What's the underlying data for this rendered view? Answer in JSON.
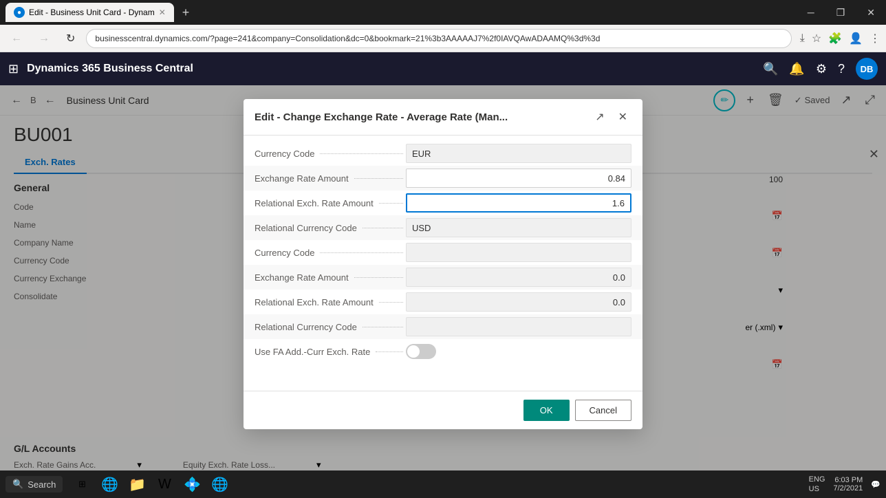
{
  "browser": {
    "tab_title": "Edit - Business Unit Card - Dynam",
    "tab_favicon": "●",
    "address_bar": "businesscentral.dynamics.com/?page=241&company=Consolidation&dc=0&bookmark=21%3b3AAAAAJ7%2f0IAVQAwADAAMQ%3d%3d",
    "win_minimize": "─",
    "win_restore": "❐",
    "win_close": "✕"
  },
  "app": {
    "title": "Dynamics 365 Business Central",
    "avatar_label": "DB"
  },
  "page": {
    "back_label": "←",
    "breadcrumb_label": "B",
    "back2_label": "←",
    "page_title": "Business Unit Card",
    "saved_label": "Saved",
    "entity_id": "BU001",
    "tab_exch_rates": "Exch. Rates",
    "section_general": "General",
    "fields": [
      {
        "label": "Code",
        "value": ""
      },
      {
        "label": "Name",
        "value": ""
      },
      {
        "label": "Company Name",
        "value": ""
      },
      {
        "label": "Currency Code",
        "value": ""
      },
      {
        "label": "Currency Exchange",
        "value": ""
      },
      {
        "label": "Consolidate",
        "value": ""
      }
    ],
    "section_gl_accounts": "G/L Accounts",
    "gl_field_exch_rate_gains": "Exch. Rate Gains Acc.",
    "gl_field_equity_exch_rate_loss": "Equity Exch. Rate Loss..."
  },
  "modal": {
    "title": "Edit - Change Exchange Rate - Average Rate (Man...",
    "fields": [
      {
        "label": "Currency Code",
        "value": "EUR",
        "type": "readonly",
        "align": "left"
      },
      {
        "label": "Exchange Rate Amount",
        "value": "0.84",
        "type": "editable",
        "align": "right"
      },
      {
        "label": "Relational Exch. Rate Amount",
        "value": "1.6",
        "type": "editable",
        "align": "right"
      },
      {
        "label": "Relational Currency Code",
        "value": "USD",
        "type": "readonly",
        "align": "left"
      },
      {
        "label": "Currency Code",
        "value": "",
        "type": "readonly",
        "align": "left"
      },
      {
        "label": "Exchange Rate Amount",
        "value": "0.0",
        "type": "readonly-right",
        "align": "right"
      },
      {
        "label": "Relational Exch. Rate Amount",
        "value": "0.0",
        "type": "readonly-right",
        "align": "right"
      },
      {
        "label": "Relational Currency Code",
        "value": "",
        "type": "readonly",
        "align": "left"
      },
      {
        "label": "Use FA Add.-Curr Exch. Rate",
        "value": "",
        "type": "toggle",
        "align": "left"
      }
    ],
    "ok_label": "OK",
    "cancel_label": "Cancel"
  },
  "taskbar": {
    "search_placeholder": "Search",
    "time": "6:03 PM",
    "date": "7/2/2021",
    "locale": "ENG\nUS"
  }
}
